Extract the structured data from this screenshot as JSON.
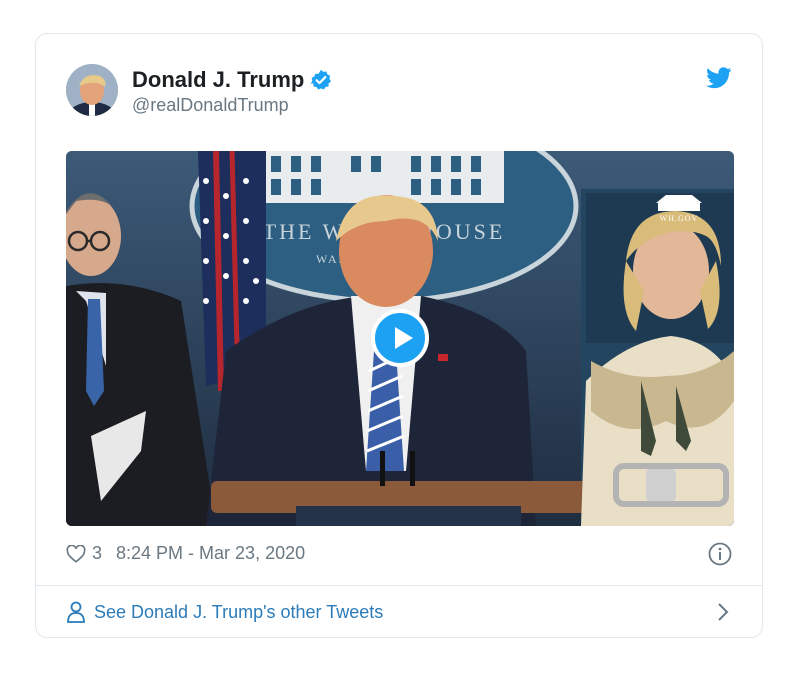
{
  "tweet": {
    "author_name": "Donald J. Trump",
    "author_handle": "@realDonaldTrump",
    "likes": "3",
    "timestamp": "8:24 PM - Mar 23, 2020",
    "footer_link": "See Donald J. Trump's other Tweets"
  },
  "media": {
    "backdrop_text": "THE WHITE HOUSE",
    "backdrop_subtext": "WAS",
    "watermark": "WH.GOV"
  },
  "colors": {
    "accent": "#1da1f2",
    "link": "#2b7bb9",
    "secondary_text": "#697882",
    "border": "#e1e8ed"
  },
  "icons": [
    "verified-badge-icon",
    "twitter-bird-icon",
    "play-icon",
    "heart-icon",
    "info-icon",
    "person-icon",
    "chevron-right-icon"
  ]
}
